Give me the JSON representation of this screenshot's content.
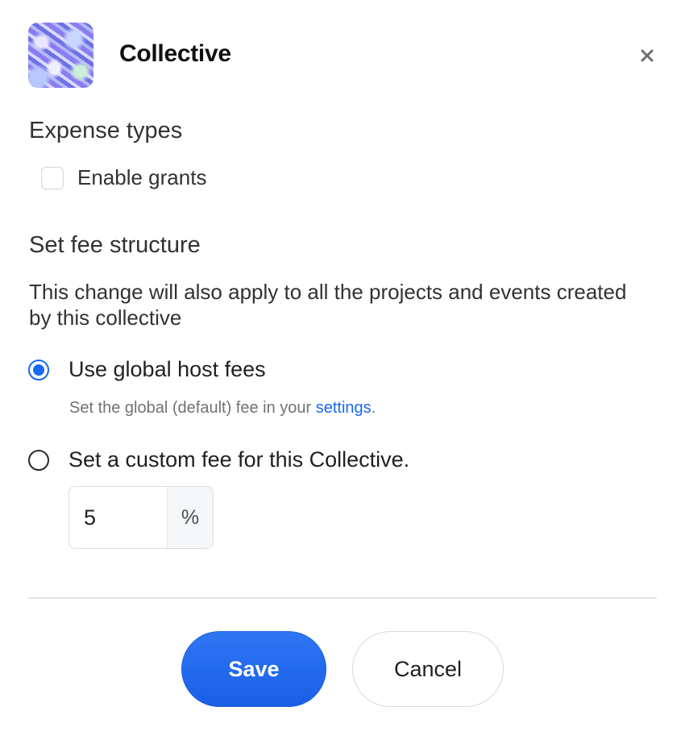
{
  "header": {
    "title": "Collective",
    "close_icon": "close-icon"
  },
  "expense_types": {
    "heading": "Expense types",
    "enable_grants_label": "Enable grants",
    "enable_grants_checked": false
  },
  "fee_structure": {
    "heading": "Set fee structure",
    "description": "This change will also apply to all the projects and events created by this collective",
    "global_option": {
      "label": "Use global host fees",
      "selected": true,
      "helper_prefix": "Set the global (default) fee in your ",
      "helper_link": "settings",
      "helper_suffix": "."
    },
    "custom_option": {
      "label": "Set a custom fee for this Collective.",
      "selected": false,
      "fee_value": "5",
      "fee_suffix": "%"
    }
  },
  "actions": {
    "save_label": "Save",
    "cancel_label": "Cancel"
  },
  "colors": {
    "accent": "#1869f5",
    "text": "#313233",
    "muted": "#707276"
  }
}
